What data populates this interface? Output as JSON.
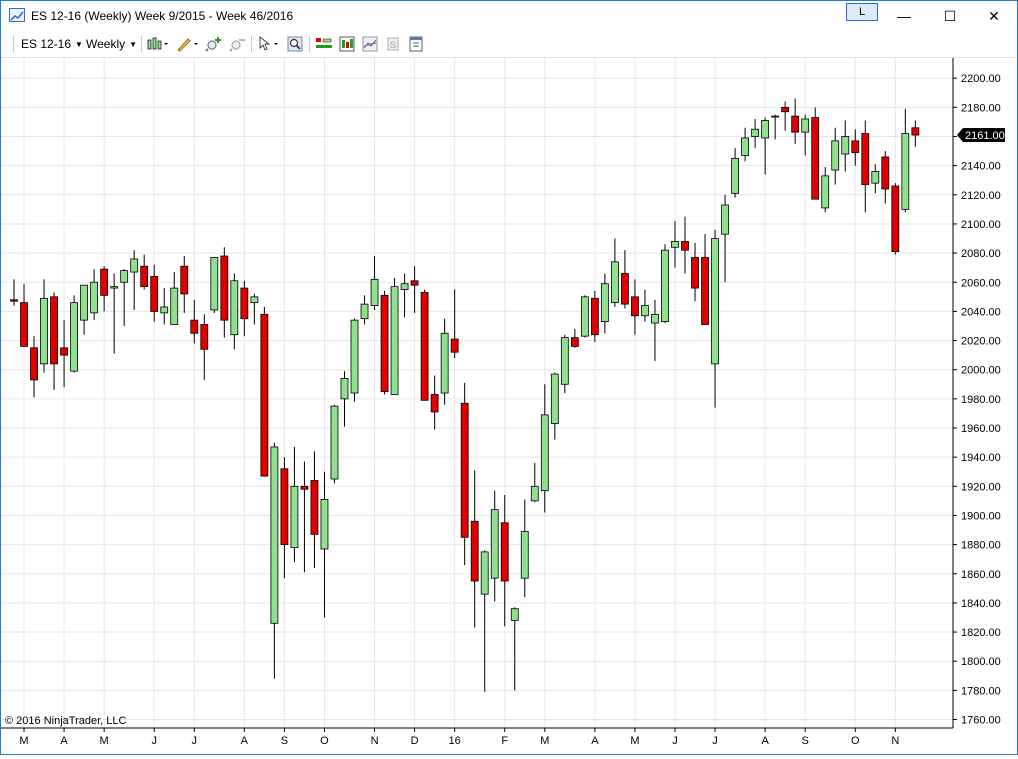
{
  "window": {
    "title": "ES 12-16 (Weekly)  Week 9/2015 - Week 46/2016",
    "link_button": "L",
    "minimize": "—",
    "maximize": "☐",
    "close": "✕"
  },
  "toolbar": {
    "instrument": "ES 12-16",
    "interval": "Weekly",
    "icons": [
      "chart-style-icon",
      "drawing-tool-icon",
      "zoom-in-icon",
      "zoom-out-icon",
      "cursor-icon",
      "search-icon",
      "bar-spacing-icon",
      "chart-style-candle-icon",
      "indicator-icon",
      "strategy-icon",
      "properties-icon"
    ]
  },
  "copyright": "© 2016 NinjaTrader, LLC",
  "colors": {
    "up": "#90e090",
    "down": "#e00000",
    "outline": "#000000",
    "grid": "#e6e6e6",
    "price_marker": "#000000"
  },
  "chart_data": {
    "type": "candlestick",
    "ylim": [
      1750,
      2210
    ],
    "yticks": [
      "1760.00",
      "1780.00",
      "1800.00",
      "1820.00",
      "1840.00",
      "1860.00",
      "1880.00",
      "1900.00",
      "1920.00",
      "1940.00",
      "1960.00",
      "1980.00",
      "2000.00",
      "2020.00",
      "2040.00",
      "2060.00",
      "2080.00",
      "2100.00",
      "2120.00",
      "2140.00",
      "2160.00",
      "2180.00",
      "2200.00"
    ],
    "last_price": "2161.00",
    "xticks": [
      {
        "label": "M",
        "bar": 1
      },
      {
        "label": "A",
        "bar": 5
      },
      {
        "label": "M",
        "bar": 9
      },
      {
        "label": "J",
        "bar": 14
      },
      {
        "label": "J",
        "bar": 18
      },
      {
        "label": "A",
        "bar": 23
      },
      {
        "label": "S",
        "bar": 27
      },
      {
        "label": "O",
        "bar": 31
      },
      {
        "label": "N",
        "bar": 36
      },
      {
        "label": "D",
        "bar": 40
      },
      {
        "label": "16",
        "bar": 44
      },
      {
        "label": "F",
        "bar": 49
      },
      {
        "label": "M",
        "bar": 53
      },
      {
        "label": "A",
        "bar": 58
      },
      {
        "label": "M",
        "bar": 62
      },
      {
        "label": "J",
        "bar": 66
      },
      {
        "label": "J",
        "bar": 70
      },
      {
        "label": "A",
        "bar": 75
      },
      {
        "label": "S",
        "bar": 79
      },
      {
        "label": "O",
        "bar": 84
      },
      {
        "label": "N",
        "bar": 88
      }
    ],
    "candles": [
      {
        "o": 2048,
        "h": 2062,
        "l": 2044,
        "c": 2047
      },
      {
        "o": 2046,
        "h": 2059,
        "l": 2016,
        "c": 2016
      },
      {
        "o": 2015,
        "h": 2023,
        "l": 1981,
        "c": 1993
      },
      {
        "o": 2004,
        "h": 2062,
        "l": 1998,
        "c": 2049
      },
      {
        "o": 2050,
        "h": 2053,
        "l": 1986,
        "c": 2004
      },
      {
        "o": 2015,
        "h": 2034,
        "l": 1988,
        "c": 2010
      },
      {
        "o": 1999,
        "h": 2051,
        "l": 1998,
        "c": 2046
      },
      {
        "o": 2034,
        "h": 2055,
        "l": 2024,
        "c": 2058
      },
      {
        "o": 2039,
        "h": 2069,
        "l": 2034,
        "c": 2060
      },
      {
        "o": 2069,
        "h": 2071,
        "l": 2040,
        "c": 2051
      },
      {
        "o": 2056,
        "h": 2066,
        "l": 2011,
        "c": 2057
      },
      {
        "o": 2060,
        "h": 2069,
        "l": 2030,
        "c": 2068
      },
      {
        "o": 2067,
        "h": 2082,
        "l": 2041,
        "c": 2076
      },
      {
        "o": 2071,
        "h": 2079,
        "l": 2055,
        "c": 2057
      },
      {
        "o": 2064,
        "h": 2072,
        "l": 2033,
        "c": 2040
      },
      {
        "o": 2039,
        "h": 2056,
        "l": 2031,
        "c": 2043
      },
      {
        "o": 2031,
        "h": 2067,
        "l": 2031,
        "c": 2056
      },
      {
        "o": 2071,
        "h": 2078,
        "l": 2039,
        "c": 2052
      },
      {
        "o": 2034,
        "h": 2048,
        "l": 2018,
        "c": 2025
      },
      {
        "o": 2031,
        "h": 2038,
        "l": 1993,
        "c": 2014
      },
      {
        "o": 2041,
        "h": 2077,
        "l": 2039,
        "c": 2077
      },
      {
        "o": 2078,
        "h": 2084,
        "l": 2022,
        "c": 2034
      },
      {
        "o": 2024,
        "h": 2066,
        "l": 2014,
        "c": 2061
      },
      {
        "o": 2056,
        "h": 2061,
        "l": 2023,
        "c": 2035
      },
      {
        "o": 2046,
        "h": 2052,
        "l": 2031,
        "c": 2050
      },
      {
        "o": 2038,
        "h": 2043,
        "l": 1927,
        "c": 1927
      },
      {
        "o": 1826,
        "h": 1950,
        "l": 1788,
        "c": 1947
      },
      {
        "o": 1932,
        "h": 1940,
        "l": 1857,
        "c": 1880
      },
      {
        "o": 1878,
        "h": 1947,
        "l": 1868,
        "c": 1920
      },
      {
        "o": 1920,
        "h": 1937,
        "l": 1861,
        "c": 1918
      },
      {
        "o": 1924,
        "h": 1944,
        "l": 1864,
        "c": 1887
      },
      {
        "o": 1877,
        "h": 1930,
        "l": 1830,
        "c": 1911
      },
      {
        "o": 1925,
        "h": 1976,
        "l": 1922,
        "c": 1975
      },
      {
        "o": 1980,
        "h": 1999,
        "l": 1961,
        "c": 1994
      },
      {
        "o": 1984,
        "h": 2035,
        "l": 1978,
        "c": 2034
      },
      {
        "o": 2035,
        "h": 2051,
        "l": 2031,
        "c": 2045
      },
      {
        "o": 2044,
        "h": 2078,
        "l": 2041,
        "c": 2062
      },
      {
        "o": 2051,
        "h": 2054,
        "l": 1983,
        "c": 1985
      },
      {
        "o": 1983,
        "h": 2063,
        "l": 1983,
        "c": 2057
      },
      {
        "o": 2055,
        "h": 2066,
        "l": 2036,
        "c": 2059
      },
      {
        "o": 2061,
        "h": 2071,
        "l": 2039,
        "c": 2058
      },
      {
        "o": 2053,
        "h": 2055,
        "l": 1979,
        "c": 1979
      },
      {
        "o": 1983,
        "h": 1996,
        "l": 1959,
        "c": 1971
      },
      {
        "o": 1984,
        "h": 2035,
        "l": 1976,
        "c": 2025
      },
      {
        "o": 2021,
        "h": 2055,
        "l": 2008,
        "c": 2012
      },
      {
        "o": 1977,
        "h": 1991,
        "l": 1866,
        "c": 1885
      },
      {
        "o": 1896,
        "h": 1931,
        "l": 1823,
        "c": 1855
      },
      {
        "o": 1846,
        "h": 1876,
        "l": 1779,
        "c": 1875
      },
      {
        "o": 1857,
        "h": 1917,
        "l": 1841,
        "c": 1904
      },
      {
        "o": 1895,
        "h": 1914,
        "l": 1824,
        "c": 1855
      },
      {
        "o": 1828,
        "h": 1837,
        "l": 1780,
        "c": 1836
      },
      {
        "o": 1857,
        "h": 1911,
        "l": 1844,
        "c": 1889
      },
      {
        "o": 1910,
        "h": 1936,
        "l": 1909,
        "c": 1920
      },
      {
        "o": 1917,
        "h": 1990,
        "l": 1902,
        "c": 1969
      },
      {
        "o": 1963,
        "h": 1998,
        "l": 1952,
        "c": 1997
      },
      {
        "o": 1990,
        "h": 2024,
        "l": 1984,
        "c": 2022
      },
      {
        "o": 2022,
        "h": 2028,
        "l": 2015,
        "c": 2016
      },
      {
        "o": 2023,
        "h": 2051,
        "l": 2022,
        "c": 2050
      },
      {
        "o": 2049,
        "h": 2054,
        "l": 2019,
        "c": 2024
      },
      {
        "o": 2033,
        "h": 2066,
        "l": 2025,
        "c": 2059
      },
      {
        "o": 2046,
        "h": 2090,
        "l": 2043,
        "c": 2074
      },
      {
        "o": 2066,
        "h": 2082,
        "l": 2042,
        "c": 2045
      },
      {
        "o": 2050,
        "h": 2062,
        "l": 2024,
        "c": 2037
      },
      {
        "o": 2037,
        "h": 2055,
        "l": 2033,
        "c": 2044
      },
      {
        "o": 2032,
        "h": 2048,
        "l": 2006,
        "c": 2038
      },
      {
        "o": 2033,
        "h": 2086,
        "l": 2032,
        "c": 2082
      },
      {
        "o": 2084,
        "h": 2102,
        "l": 2070,
        "c": 2088
      },
      {
        "o": 2088,
        "h": 2105,
        "l": 2066,
        "c": 2082
      },
      {
        "o": 2077,
        "h": 2087,
        "l": 2047,
        "c": 2056
      },
      {
        "o": 2077,
        "h": 2093,
        "l": 2031,
        "c": 2031
      },
      {
        "o": 2004,
        "h": 2096,
        "l": 1974,
        "c": 2090
      },
      {
        "o": 2093,
        "h": 2120,
        "l": 2060,
        "c": 2113
      },
      {
        "o": 2121,
        "h": 2152,
        "l": 2118,
        "c": 2145
      },
      {
        "o": 2147,
        "h": 2166,
        "l": 2143,
        "c": 2159
      },
      {
        "o": 2160,
        "h": 2172,
        "l": 2152,
        "c": 2165
      },
      {
        "o": 2159,
        "h": 2173,
        "l": 2134,
        "c": 2171
      },
      {
        "o": 2174,
        "h": 2175,
        "l": 2158,
        "c": 2174
      },
      {
        "o": 2180,
        "h": 2184,
        "l": 2164,
        "c": 2177
      },
      {
        "o": 2174,
        "h": 2186,
        "l": 2155,
        "c": 2163
      },
      {
        "o": 2163,
        "h": 2175,
        "l": 2147,
        "c": 2172
      },
      {
        "o": 2173,
        "h": 2180,
        "l": 2117,
        "c": 2117
      },
      {
        "o": 2111,
        "h": 2139,
        "l": 2108,
        "c": 2133
      },
      {
        "o": 2137,
        "h": 2166,
        "l": 2127,
        "c": 2157
      },
      {
        "o": 2148,
        "h": 2171,
        "l": 2136,
        "c": 2160
      },
      {
        "o": 2157,
        "h": 2165,
        "l": 2140,
        "c": 2149
      },
      {
        "o": 2162,
        "h": 2171,
        "l": 2108,
        "c": 2127
      },
      {
        "o": 2128,
        "h": 2141,
        "l": 2121,
        "c": 2136
      },
      {
        "o": 2146,
        "h": 2150,
        "l": 2114,
        "c": 2124
      },
      {
        "o": 2126,
        "h": 2128,
        "l": 2079,
        "c": 2081
      },
      {
        "o": 2110,
        "h": 2179,
        "l": 2108,
        "c": 2162
      },
      {
        "o": 2166,
        "h": 2171,
        "l": 2153,
        "c": 2161
      }
    ]
  }
}
